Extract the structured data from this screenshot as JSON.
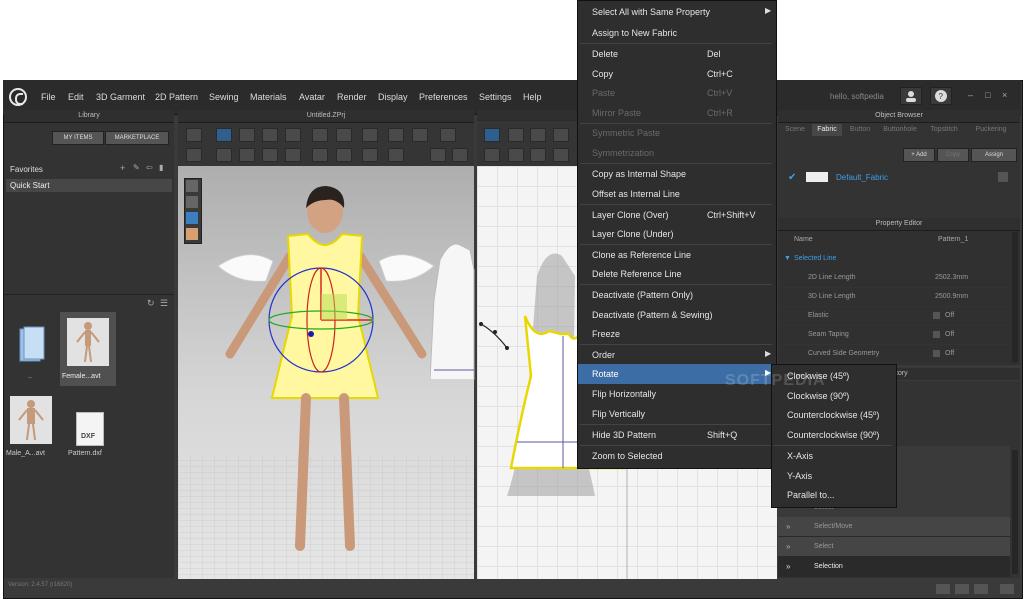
{
  "app": {
    "menus": [
      "File",
      "Edit",
      "3D Garment",
      "2D Pattern",
      "Sewing",
      "Materials",
      "Avatar",
      "Render",
      "Display",
      "Preferences",
      "Settings",
      "Help"
    ],
    "user": "hello, softpedia",
    "version": "Version: 2.4.57 (r16820)"
  },
  "library": {
    "title": "Library",
    "my_items": "MY ITEMS",
    "marketplace": "MARKETPLACE",
    "favorites": "Favorites",
    "quick_start": "Quick Start",
    "files": [
      {
        "name": "..",
        "icon": "folder-icon"
      },
      {
        "name": "Female...avt",
        "icon": "female-avatar-icon"
      },
      {
        "name": "Male_A...avt",
        "icon": "male-avatar-icon"
      },
      {
        "name": "Pattern.dxf",
        "icon": "dxf-file-icon",
        "badge": "DXF"
      }
    ]
  },
  "viewport3d": {
    "title": "Untitled.ZPrj"
  },
  "object_browser": {
    "title": "Object Browser",
    "tabs": [
      "Scene",
      "Fabric",
      "Button",
      "Buttonhole",
      "Topstitch",
      "Puckering"
    ],
    "active_tab": "Fabric",
    "add": "+ Add",
    "copy": "Copy",
    "assign": "Assign",
    "fabric_name": "Default_Fabric"
  },
  "property_editor": {
    "title": "Property Editor",
    "name_label": "Name",
    "name_value": "Pattern_1",
    "section": "Selected Line",
    "rows": [
      {
        "label": "2D Line Length",
        "value": "2502.3mm"
      },
      {
        "label": "3D Line Length",
        "value": "2500.9mm"
      },
      {
        "label": "Elastic",
        "value": "Off"
      },
      {
        "label": "Seam Taping",
        "value": "Off"
      },
      {
        "label": "Curved Side Geometry",
        "value": "Off"
      }
    ]
  },
  "history": {
    "title_fragment": "tory",
    "rows": [
      {
        "label": "Select/Move"
      },
      {
        "label": "Select"
      },
      {
        "label": "Selection"
      }
    ],
    "partial_row": "Select"
  },
  "context_menu": {
    "items": [
      {
        "label": "Select All with Same Property",
        "shortcut": "",
        "enabled": true,
        "submenu": true
      },
      {
        "label": "Assign to New Fabric",
        "shortcut": "",
        "enabled": true
      },
      {
        "label": "Delete",
        "shortcut": "Del",
        "enabled": true
      },
      {
        "label": "Copy",
        "shortcut": "Ctrl+C",
        "enabled": true
      },
      {
        "label": "Paste",
        "shortcut": "Ctrl+V",
        "enabled": false
      },
      {
        "label": "Mirror Paste",
        "shortcut": "Ctrl+R",
        "enabled": false
      },
      {
        "label": "Symmetric Paste",
        "shortcut": "",
        "enabled": false
      },
      {
        "label": "Symmetrization",
        "shortcut": "",
        "enabled": false
      },
      {
        "label": "Copy as Internal Shape",
        "shortcut": "",
        "enabled": true
      },
      {
        "label": "Offset as Internal Line",
        "shortcut": "",
        "enabled": true
      },
      {
        "label": "Layer Clone (Over)",
        "shortcut": "Ctrl+Shift+V",
        "enabled": true
      },
      {
        "label": "Layer Clone (Under)",
        "shortcut": "",
        "enabled": true
      },
      {
        "label": "Clone as Reference Line",
        "shortcut": "",
        "enabled": true
      },
      {
        "label": "Delete Reference Line",
        "shortcut": "",
        "enabled": true
      },
      {
        "label": "Deactivate (Pattern Only)",
        "shortcut": "",
        "enabled": true
      },
      {
        "label": "Deactivate (Pattern & Sewing)",
        "shortcut": "",
        "enabled": true
      },
      {
        "label": "Freeze",
        "shortcut": "",
        "enabled": true
      },
      {
        "label": "Order",
        "shortcut": "",
        "enabled": true,
        "submenu": true
      },
      {
        "label": "Rotate",
        "shortcut": "",
        "enabled": true,
        "submenu": true,
        "highlighted": true
      },
      {
        "label": "Flip Horizontally",
        "shortcut": "",
        "enabled": true
      },
      {
        "label": "Flip Vertically",
        "shortcut": "",
        "enabled": true
      },
      {
        "label": "Hide 3D Pattern",
        "shortcut": "Shift+Q",
        "enabled": true
      },
      {
        "label": "Zoom to Selected",
        "shortcut": "",
        "enabled": true
      }
    ],
    "highlight_color": "#3c6da4"
  },
  "rotate_submenu": {
    "items": [
      "Clockwise (45º)",
      "Clockwise (90º)",
      "Counterclockwise (45º)",
      "Counterclockwise (90º)",
      "X-Axis",
      "Y-Axis",
      "Parallel to..."
    ]
  },
  "watermark": "SOFTPEDIA",
  "colors": {
    "accent": "#3aa0e8",
    "garment": "#fff8a0",
    "garment_outline": "#e8d800"
  }
}
